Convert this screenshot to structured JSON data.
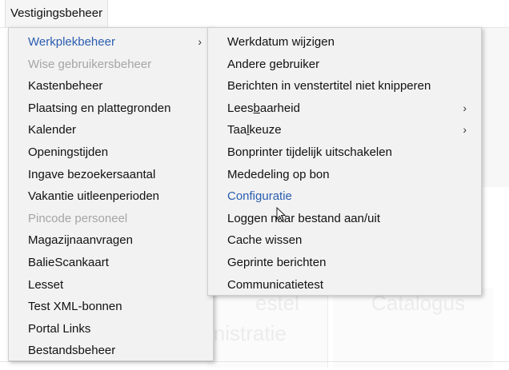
{
  "menubar": {
    "title": "Vestigingsbeheer"
  },
  "primary_menu": {
    "items": [
      {
        "label": "Werkplekbeheer",
        "state": "highlighted",
        "has_submenu": true
      },
      {
        "label": "Wise gebruikersbeheer",
        "state": "disabled",
        "has_submenu": false
      },
      {
        "label": "Kastenbeheer",
        "state": "normal",
        "has_submenu": false
      },
      {
        "label": "Plaatsing en plattegronden",
        "state": "normal",
        "has_submenu": false
      },
      {
        "label": "Kalender",
        "state": "normal",
        "has_submenu": false
      },
      {
        "label": "Openingstijden",
        "state": "normal",
        "has_submenu": false
      },
      {
        "label": "Ingave bezoekersaantal",
        "state": "normal",
        "has_submenu": false
      },
      {
        "label": "Vakantie uitleenperioden",
        "state": "normal",
        "has_submenu": false
      },
      {
        "label": "Pincode personeel",
        "state": "disabled",
        "has_submenu": false
      },
      {
        "label": "Magazijnaanvragen",
        "state": "normal",
        "has_submenu": false
      },
      {
        "label": "BalieScankaart",
        "state": "normal",
        "has_submenu": false
      },
      {
        "label": "Lesset",
        "state": "normal",
        "has_submenu": false
      },
      {
        "label": "Test XML-bonnen",
        "state": "normal",
        "has_submenu": false
      },
      {
        "label": "Portal Links",
        "state": "normal",
        "has_submenu": false
      },
      {
        "label": "Bestandsbeheer",
        "state": "normal",
        "has_submenu": false
      }
    ]
  },
  "secondary_menu": {
    "items": [
      {
        "label": "Werkdatum wijzigen",
        "state": "normal",
        "has_submenu": false
      },
      {
        "label": "Andere gebruiker",
        "state": "normal",
        "has_submenu": false
      },
      {
        "label": "Berichten in venstertitel niet knipperen",
        "state": "normal",
        "has_submenu": false
      },
      {
        "label_pre": "Lees",
        "label_u": "b",
        "label_post": "aarheid",
        "state": "normal",
        "has_submenu": true
      },
      {
        "label_pre": "Taa",
        "label_u": "l",
        "label_post": "keuze",
        "state": "normal",
        "has_submenu": true
      },
      {
        "label": "Bonprinter tijdelijk uitschakelen",
        "state": "normal",
        "has_submenu": false
      },
      {
        "label": "Mededeling op bon",
        "state": "normal",
        "has_submenu": false
      },
      {
        "label": "Configuratie",
        "state": "hover",
        "has_submenu": false
      },
      {
        "label": "Loggen naar bestand aan/uit",
        "state": "normal",
        "has_submenu": false
      },
      {
        "label": "Cache wissen",
        "state": "normal",
        "has_submenu": false
      },
      {
        "label": "Geprinte berichten",
        "state": "normal",
        "has_submenu": false
      },
      {
        "label": "Communicatietest",
        "state": "normal",
        "has_submenu": false
      }
    ]
  },
  "background": {
    "tile_left_line1": "estel",
    "tile_left_line2": "inistratie",
    "tile_right": "Catalogus"
  },
  "icons": {
    "submenu_arrow": "chevron-right-icon",
    "cursor": "mouse-pointer-icon"
  },
  "colors": {
    "highlight": "#2a5db0",
    "disabled": "#a5a5a5",
    "menu_bg": "#f2f2f2"
  }
}
